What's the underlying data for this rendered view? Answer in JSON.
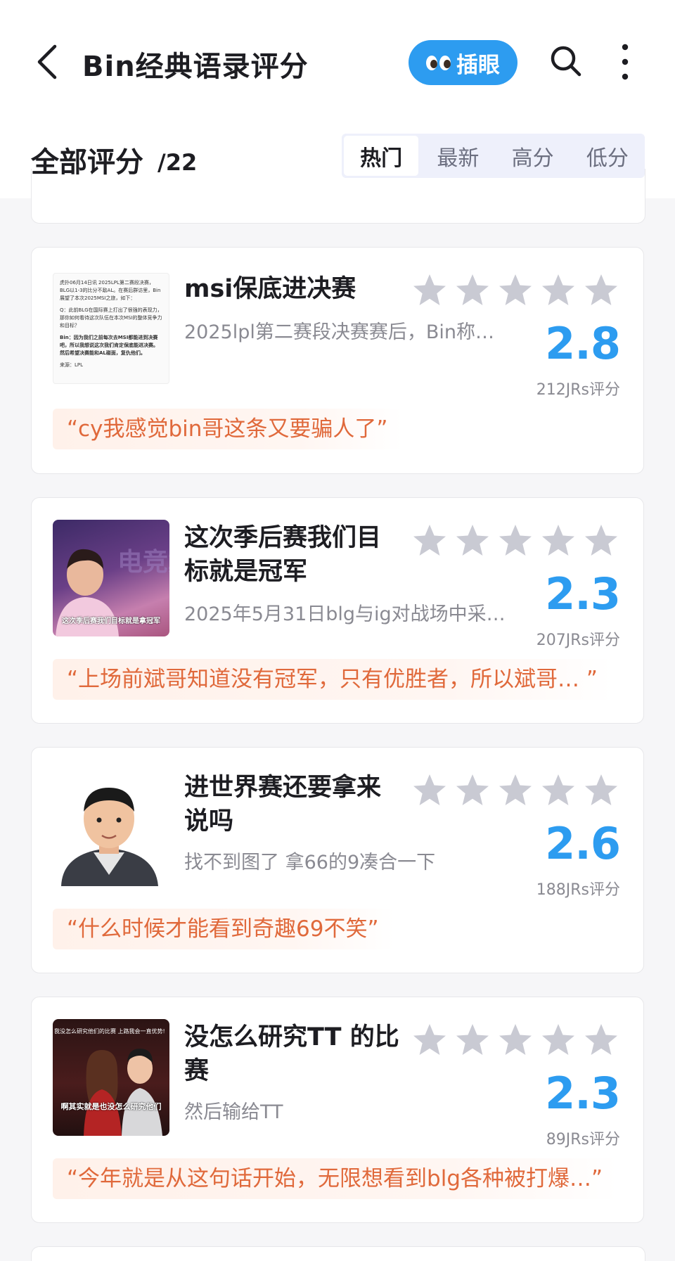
{
  "header": {
    "title": "Bin经典语录评分",
    "peek_label": "插眼",
    "back_icon": "chevron-left-icon",
    "search_icon": "search-icon",
    "more_icon": "more-vertical-icon"
  },
  "section": {
    "title": "全部评分",
    "count": "/22",
    "tabs": [
      "热门",
      "最新",
      "高分",
      "低分"
    ],
    "active_tab": "热门"
  },
  "colors": {
    "accent": "#2d9cf0",
    "quote": "#e0693b",
    "star_empty": "#c9cad3"
  },
  "cards": [
    {
      "title": "msi保底进决赛",
      "desc": "2025lpl第二赛段决赛赛后，Bin称…",
      "score": "2.8",
      "rating_count": "212JRs评分",
      "quote": "“cy我感觉bin哥这条又要骗人了”",
      "stars_filled": 0,
      "thumb": {
        "line1": "虎扑06月14日讯 2025LPL第二赛段决赛，BLG以1-3的比分不敌AL。在赛后群访里，Bin展望了本次2025MSI之旅，如下：",
        "line2": "Q：此前BLG在国际赛上打出了很强的表现力，那你如何看待这次队伍在本次MSI的整体竞争力和目标？",
        "line3": "Bin：因为我们之前每次去MSI都能进到决赛吧，所以我想说这次我们肯定保底能进决赛。然后希望决赛能和AL碰面，复仇他们。",
        "line4": "来源：LPL"
      }
    },
    {
      "title": "这次季后赛我们目标就是冠军",
      "desc": "2025年5月31日blg与ig对战场中采…",
      "score": "2.3",
      "rating_count": "207JRs评分",
      "quote": "“上场前斌哥知道没有冠军，只有优胜者，所以斌哥… ”",
      "stars_filled": 0,
      "thumb": {
        "caption": "这次季后赛我们目标就是拿冠军"
      }
    },
    {
      "title": "进世界赛还要拿来说吗",
      "desc": "找不到图了 拿66的9凑合一下",
      "score": "2.6",
      "rating_count": "188JRs评分",
      "quote": "“什么时候才能看到奇趣69不笑”",
      "stars_filled": 0,
      "thumb": {}
    },
    {
      "title": "没怎么研究TT 的比赛",
      "desc": "然后输给TT",
      "score": "2.3",
      "rating_count": "89JRs评分",
      "quote": "“今年就是从这句话开始，无限想看到blg各种被打爆…”",
      "stars_filled": 0,
      "thumb": {
        "top": "我没怎么研究他们的比赛 上路我会一直优势!",
        "caption": "啊其实就是也没怎么研究他们"
      }
    }
  ]
}
